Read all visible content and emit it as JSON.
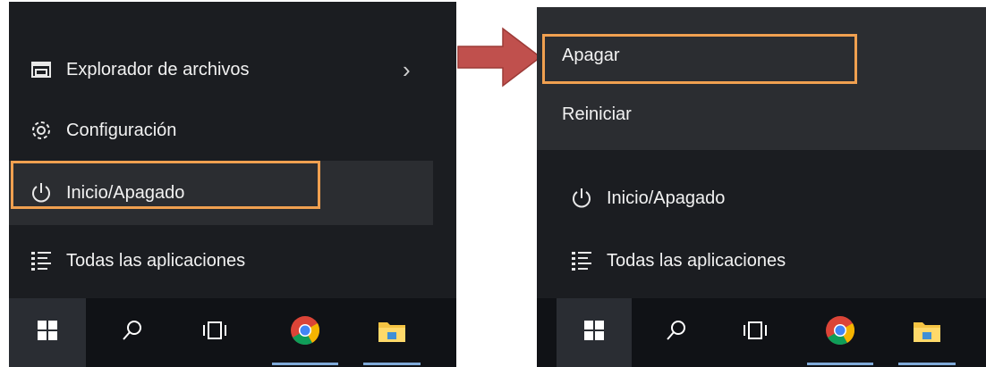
{
  "left_menu": {
    "items": [
      {
        "label": "Explorador de archivos",
        "icon": "file-explorer-icon",
        "chevron": "›"
      },
      {
        "label": "Configuración",
        "icon": "gear-icon"
      },
      {
        "label": "Inicio/Apagado",
        "icon": "power-icon",
        "highlighted": true
      },
      {
        "label": "Todas las aplicaciones",
        "icon": "all-apps-icon"
      }
    ]
  },
  "right_menu": {
    "power_options": [
      {
        "label": "Apagar",
        "highlighted": true
      },
      {
        "label": "Reiniciar"
      }
    ],
    "items": [
      {
        "label": "Inicio/Apagado",
        "icon": "power-icon"
      },
      {
        "label": "Todas las aplicaciones",
        "icon": "all-apps-icon"
      }
    ]
  },
  "taskbar": {
    "buttons": [
      "windows-start-icon",
      "search-icon",
      "task-view-icon",
      "chrome-icon",
      "file-explorer-folder-icon"
    ]
  },
  "colors": {
    "panel_bg": "#1b1d21",
    "taskbar_bg": "#101216",
    "highlight": "#f0a050",
    "arrow": "#c0504d",
    "text": "#f2f2f2"
  }
}
